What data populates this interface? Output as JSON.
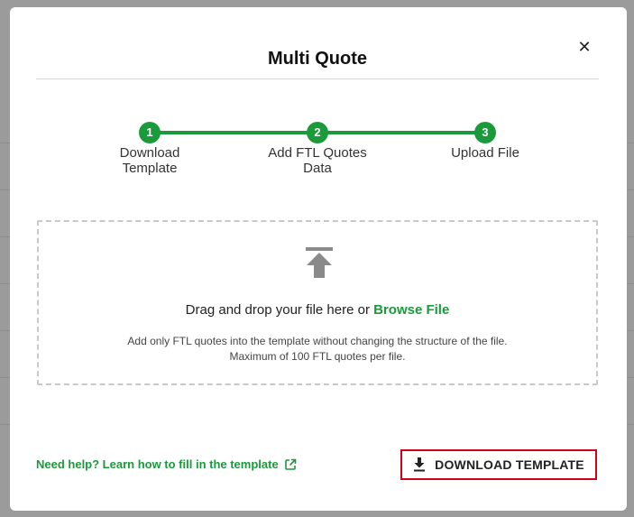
{
  "modal": {
    "title": "Multi Quote",
    "close_icon": "close-icon"
  },
  "stepper": {
    "steps": [
      {
        "number": "1",
        "label": "Download\nTemplate"
      },
      {
        "number": "2",
        "label": "Add FTL Quotes\nData"
      },
      {
        "number": "3",
        "label": "Upload File"
      }
    ],
    "accent": "#1a9a3a"
  },
  "dropzone": {
    "icon": "upload-icon",
    "prompt": "Drag and drop your file here or ",
    "browse_label": "Browse File",
    "hint_line1": "Add only FTL quotes into the template without changing the structure of the file.",
    "hint_line2": "Maximum of 100 FTL quotes per file."
  },
  "footer": {
    "help_link": "Need help? Learn how to fill in the template",
    "help_icon": "external-link-icon",
    "download_label": "DOWNLOAD TEMPLATE",
    "download_icon": "download-icon",
    "highlight_color": "#d0021b"
  }
}
